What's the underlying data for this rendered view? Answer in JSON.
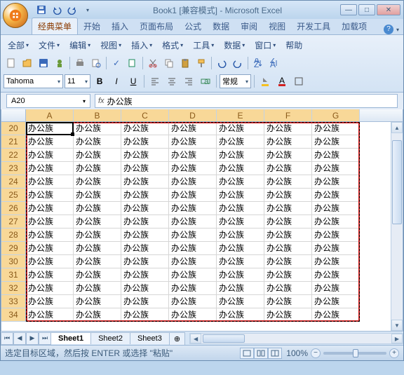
{
  "title": {
    "book": "Book1",
    "mode": "[兼容模式]",
    "app": "- Microsoft Excel"
  },
  "tabs": [
    "经典菜单",
    "开始",
    "插入",
    "页面布局",
    "公式",
    "数据",
    "审阅",
    "视图",
    "开发工具",
    "加载项"
  ],
  "menubar": [
    "全部",
    "文件",
    "编辑",
    "视图",
    "插入",
    "格式",
    "工具",
    "数据",
    "窗口",
    "帮助"
  ],
  "font": {
    "name": "Tahoma",
    "size": "11"
  },
  "style_label": "常规",
  "namebox": "A20",
  "formula": "办公族",
  "columns": [
    "A",
    "B",
    "C",
    "D",
    "E",
    "F",
    "G"
  ],
  "rownums": [
    "20",
    "21",
    "22",
    "23",
    "24",
    "25",
    "26",
    "27",
    "28",
    "29",
    "30",
    "31",
    "32",
    "33",
    "34"
  ],
  "cell_value": "办公族",
  "sheets": [
    "Sheet1",
    "Sheet2",
    "Sheet3"
  ],
  "status_text": "选定目标区域，然后按 ENTER 或选择 \"粘贴\"",
  "zoom": "100%"
}
